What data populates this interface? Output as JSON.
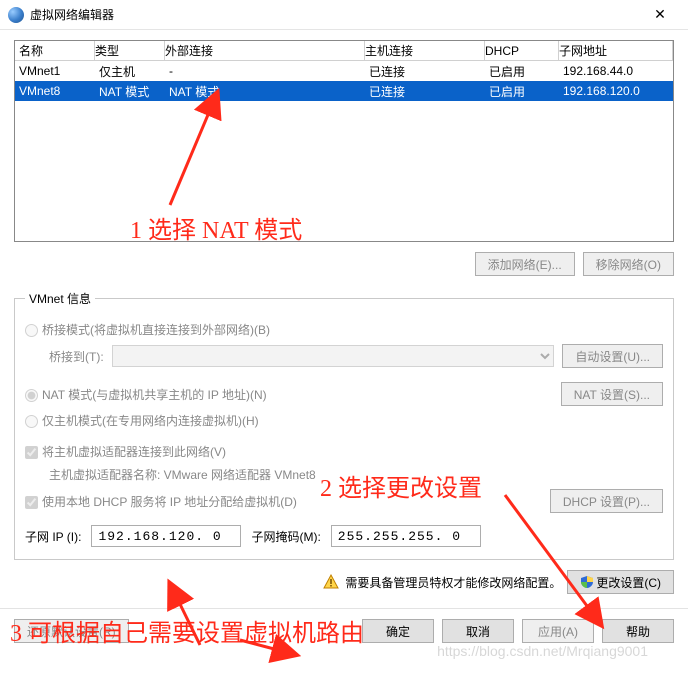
{
  "window": {
    "title": "虚拟网络编辑器"
  },
  "grid": {
    "headers": {
      "name": "名称",
      "type": "类型",
      "external": "外部连接",
      "host": "主机连接",
      "dhcp": "DHCP",
      "subnet": "子网地址"
    },
    "rows": [
      {
        "name": "VMnet1",
        "type": "仅主机",
        "external": "-",
        "host": "已连接",
        "dhcp": "已启用",
        "subnet": "192.168.44.0"
      },
      {
        "name": "VMnet8",
        "type": "NAT 模式",
        "external": "NAT 模式",
        "host": "已连接",
        "dhcp": "已启用",
        "subnet": "192.168.120.0"
      }
    ]
  },
  "btns": {
    "addNetwork": "添加网络(E)...",
    "removeNetwork": "移除网络(O)",
    "autoset": "自动设置(U)...",
    "natset": "NAT 设置(S)...",
    "dhcpset": "DHCP 设置(P)...",
    "changeSettings": "更改设置(C)",
    "restore": "还原默认设置(R)",
    "ok": "确定",
    "cancel": "取消",
    "apply": "应用(A)",
    "help": "帮助"
  },
  "vmnet": {
    "legend": "VMnet 信息",
    "bridged": "桥接模式(将虚拟机直接连接到外部网络)(B)",
    "bridgeToLabel": "桥接到(T):",
    "nat": "NAT 模式(与虚拟机共享主机的 IP 地址)(N)",
    "hostonly": "仅主机模式(在专用网络内连接虚拟机)(H)",
    "connectHost": "将主机虚拟适配器连接到此网络(V)",
    "adapterLabel": "主机虚拟适配器名称: VMware 网络适配器 VMnet8",
    "useDhcp": "使用本地 DHCP 服务将 IP 地址分配给虚拟机(D)"
  },
  "subnet": {
    "ipLabel": "子网 IP (I):",
    "ipValue": "192.168.120. 0",
    "maskLabel": "子网掩码(M):",
    "maskValue": "255.255.255. 0"
  },
  "warn": {
    "text": "需要具备管理员特权才能修改网络配置。"
  },
  "annotations": {
    "a1": "1 选择 NAT 模式",
    "a2": "2 选择更改设置",
    "a3": "3 可根据自己需要设置虚拟机路由"
  },
  "watermark": "https://blog.csdn.net/Mrqiang9001"
}
